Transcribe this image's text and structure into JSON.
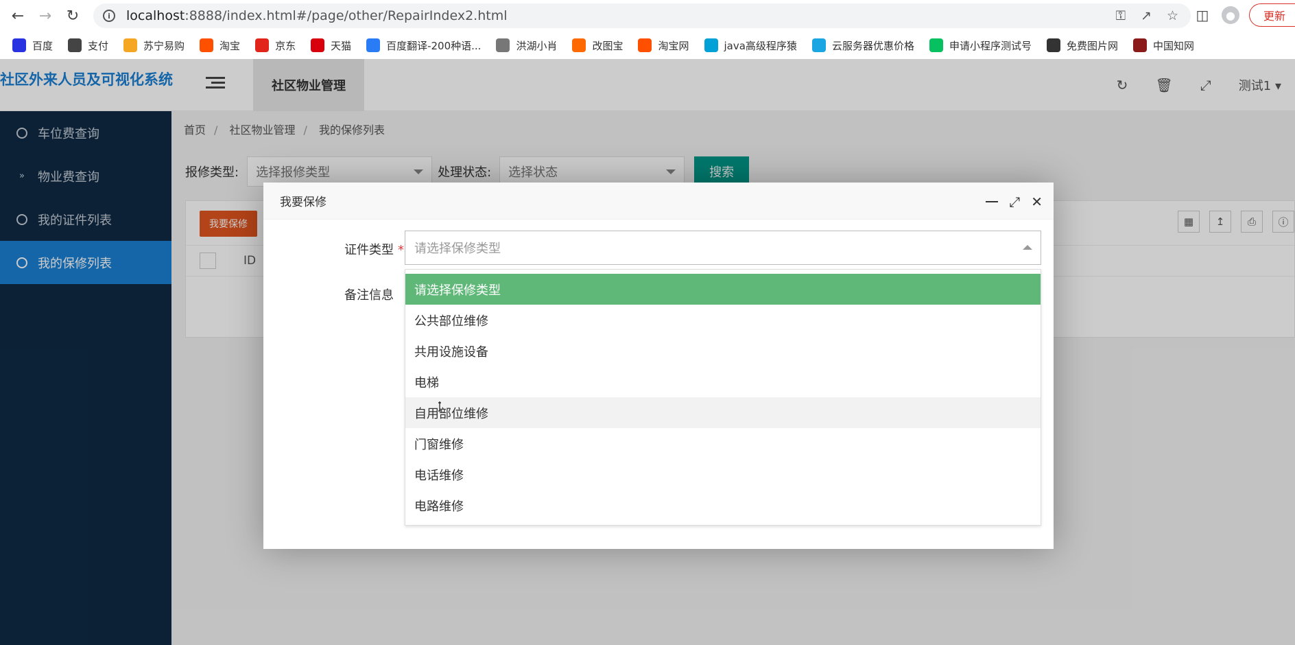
{
  "browser": {
    "url_prefix": "localhost",
    "url_rest": ":8888/index.html#/page/other/RepairIndex2.html",
    "update_label": "更新",
    "bookmarks": [
      {
        "label": "百度",
        "color": "#2932e1",
        "icon": "paw-icon"
      },
      {
        "label": "支付",
        "color": "#444444",
        "icon": "globe-icon"
      },
      {
        "label": "苏宁易购",
        "color": "#f5a623",
        "icon": "suning-icon"
      },
      {
        "label": "淘宝",
        "color": "#ff5000",
        "icon": "taobao-icon"
      },
      {
        "label": "京东",
        "color": "#e1251b",
        "icon": "jd-icon"
      },
      {
        "label": "天猫",
        "color": "#d8000c",
        "icon": "tmall-icon"
      },
      {
        "label": "百度翻译-200种语...",
        "color": "#2a7cf6",
        "icon": "translate-icon"
      },
      {
        "label": "洪湖小肖",
        "color": "#777777",
        "icon": "bird-icon"
      },
      {
        "label": "改图宝",
        "color": "#ff6a00",
        "icon": "image-icon"
      },
      {
        "label": "淘宝网",
        "color": "#ff5000",
        "icon": "taobao-icon"
      },
      {
        "label": "java高级程序猿",
        "color": "#00a1d6",
        "icon": "bilibili-icon"
      },
      {
        "label": "云服务器优惠价格",
        "color": "#1aa5e3",
        "icon": "cloud-icon"
      },
      {
        "label": "申请小程序测试号",
        "color": "#07c160",
        "icon": "wechat-icon"
      },
      {
        "label": "免费图片网",
        "color": "#333333",
        "icon": "tumblr-icon"
      },
      {
        "label": "中国知网",
        "color": "#8b1a1a",
        "icon": "cnki-icon"
      }
    ]
  },
  "app": {
    "logo": "社区外来人员及可视化系统",
    "top_tab": "社区物业管理",
    "user": "测试1",
    "sidebar": [
      {
        "label": "车位费查询",
        "icon": "dashboard-icon"
      },
      {
        "label": "物业费查询",
        "icon": "chevron-down-icon"
      },
      {
        "label": "我的证件列表",
        "icon": "circle-dot-icon"
      },
      {
        "label": "我的保修列表",
        "icon": "circle-dot-icon",
        "active": true
      }
    ],
    "breadcrumb": [
      "首页",
      "社区物业管理",
      "我的保修列表"
    ],
    "filters": {
      "type_label": "报修类型:",
      "type_placeholder": "选择报修类型",
      "status_label": "处理状态:",
      "status_placeholder": "选择状态",
      "search_label": "搜索"
    },
    "add_button": "我要保修",
    "table_header_id": "ID"
  },
  "modal": {
    "title": "我要保修",
    "field_type_label": "证件类型",
    "field_type_placeholder": "请选择保修类型",
    "field_note_label": "备注信息",
    "options": [
      "请选择保修类型",
      "公共部位维修",
      "共用设施设备",
      "电梯",
      "自用部位维修",
      "门窗维修",
      "电话维修",
      "电路维修"
    ],
    "selected_index": 0,
    "hover_index": 4,
    "colors": {
      "selected_bg": "#5fb878",
      "accent": "#009688",
      "danger": "#e0541e",
      "sidebar": "#0f2a43",
      "sidebar_active": "#1b80d4"
    }
  }
}
